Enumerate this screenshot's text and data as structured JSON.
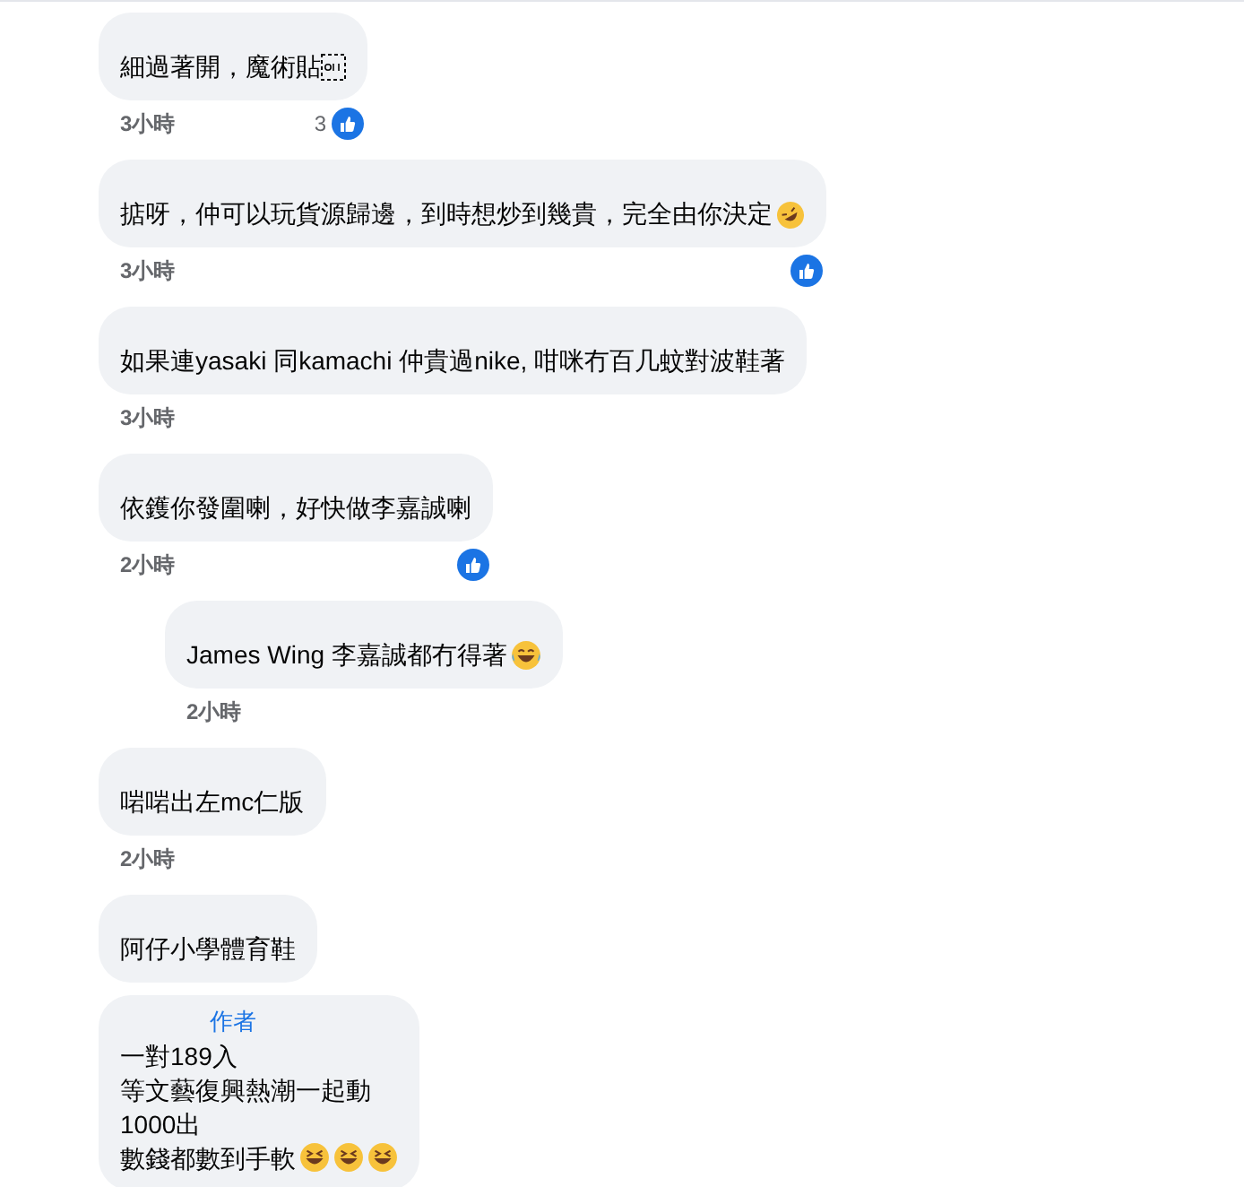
{
  "comments": [
    {
      "text": "細過著開，魔術貼",
      "object_placeholder": true,
      "time": "3小時",
      "reply": false,
      "liked": true,
      "like_count": "3"
    },
    {
      "text": "掂呀，仲可以玩貨源歸邊，到時想炒到幾貴，完全由你決定",
      "emojis": [
        {
          "kind": "rofl"
        }
      ],
      "time": "3小時",
      "reply": false,
      "liked": true
    },
    {
      "text": "如果連yasaki 同kamachi 仲貴過nike, 咁咪冇百几蚊對波鞋著",
      "time": "3小時",
      "reply": false,
      "liked": false
    },
    {
      "text": "依鑊你發圍喇，好快做李嘉誠喇",
      "time": "2小時",
      "reply": false,
      "liked": true
    },
    {
      "text": "James Wing 李嘉誠都冇得著",
      "emojis": [
        {
          "kind": "tears_of_joy"
        }
      ],
      "time": "2小時",
      "reply": true,
      "liked": false
    },
    {
      "text": "啱啱出左mc仁版",
      "time": "2小時",
      "reply": false,
      "liked": false
    },
    {
      "text": "阿仔小學體育鞋",
      "reply": false,
      "liked": false
    },
    {
      "badge": "作者",
      "lines": [
        "一對189入",
        "等文藝復興熱潮一起動",
        "1000出",
        "數錢都數到手軟"
      ],
      "emojis": [
        {
          "kind": "grin_squint"
        },
        {
          "kind": "grin_squint"
        },
        {
          "kind": "grin_squint"
        }
      ],
      "reply": false,
      "liked": false
    }
  ]
}
